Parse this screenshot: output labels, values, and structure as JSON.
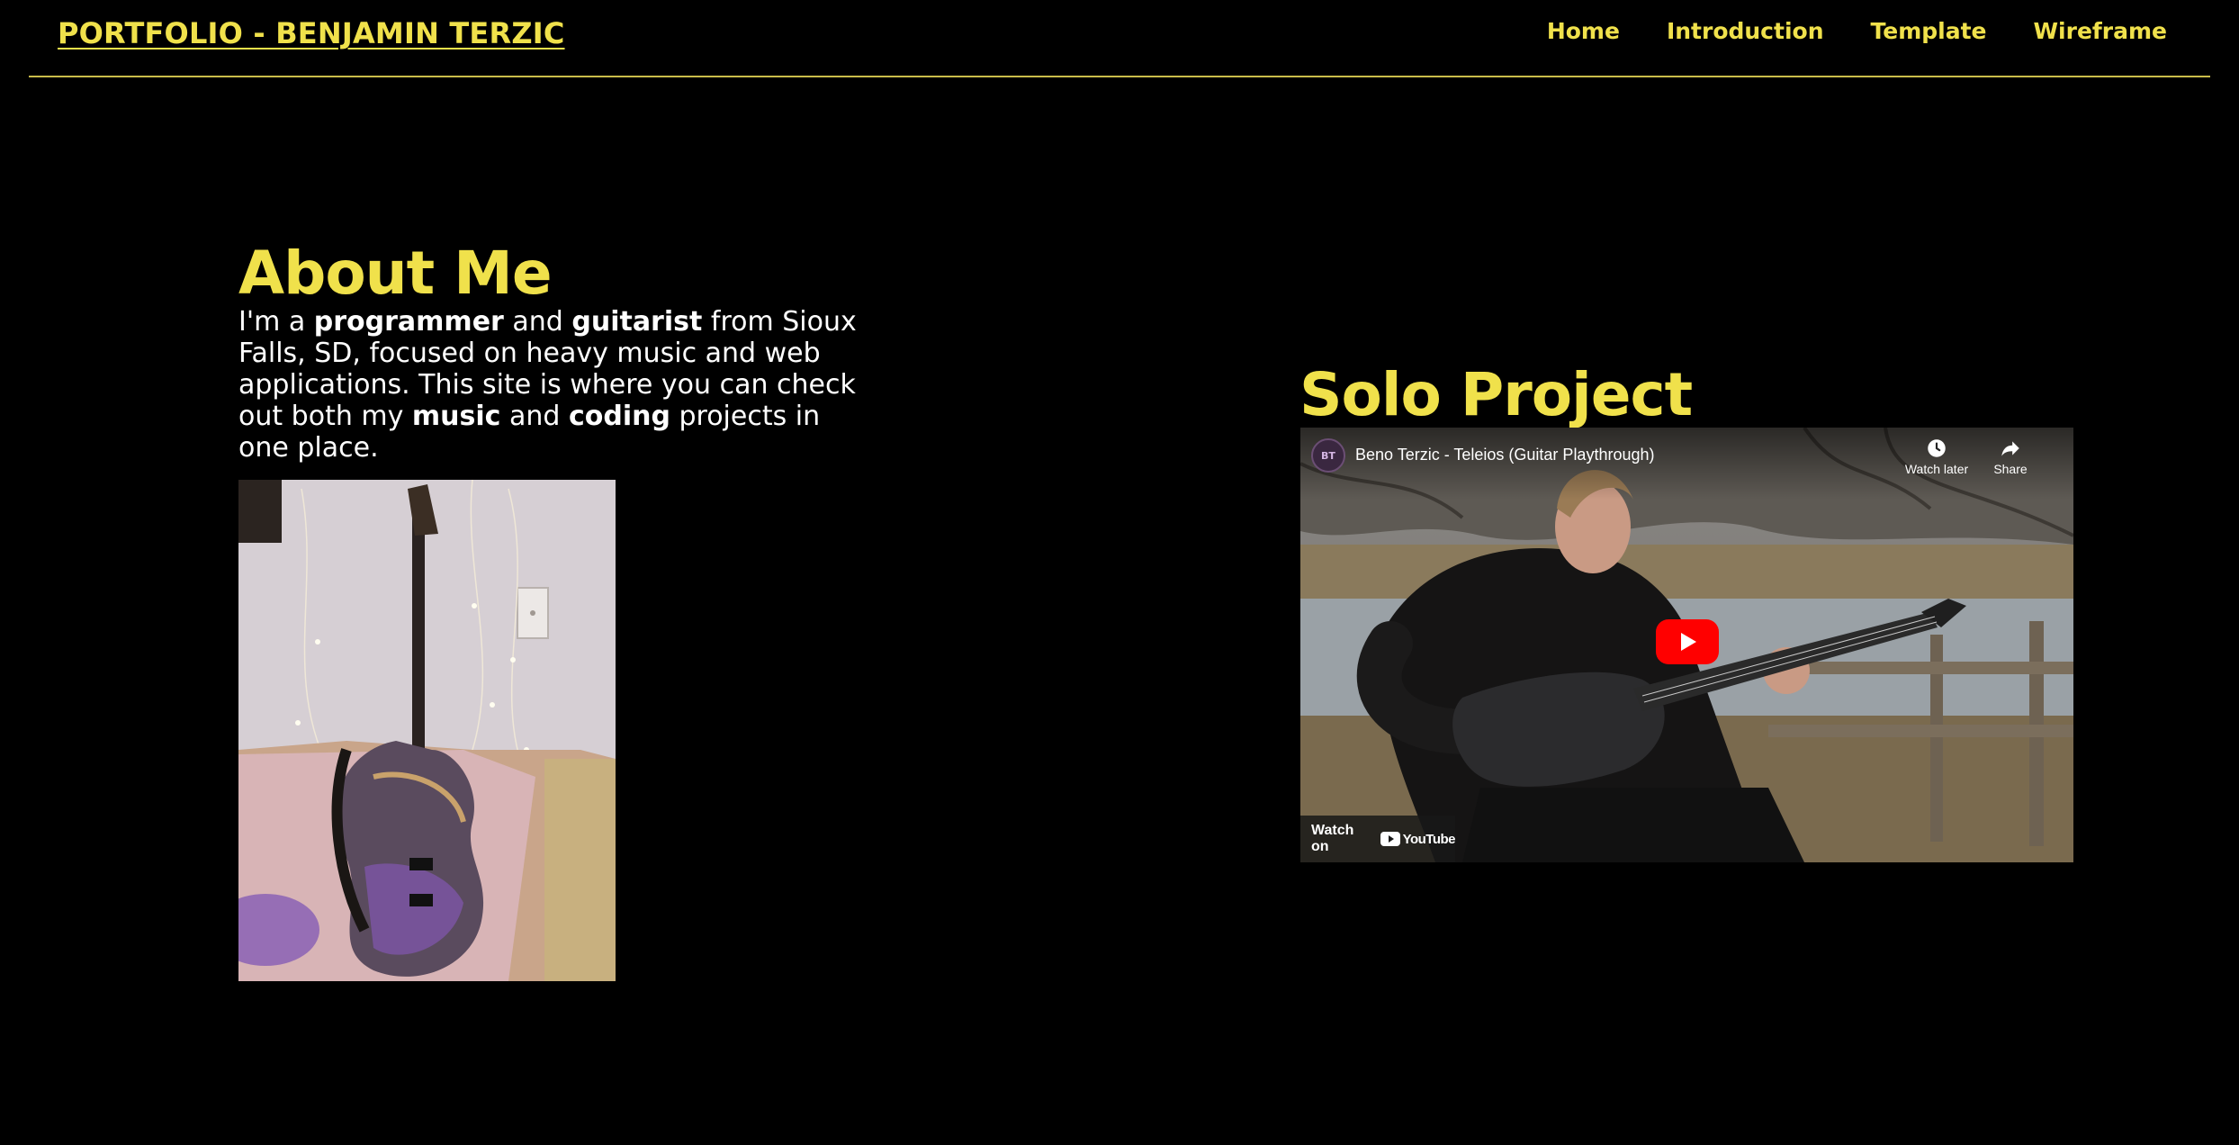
{
  "header": {
    "brand": "PORTFOLIO - BENJAMIN TERZIC",
    "nav": [
      "Home",
      "Introduction",
      "Template",
      "Wireframe"
    ]
  },
  "about": {
    "title": "About Me",
    "text_parts": [
      "I'm a ",
      "programmer",
      " and ",
      "guitarist",
      " from Sioux Falls, SD, focused on heavy music and web applications. This site is where you can check out both my ",
      "music",
      " and ",
      "coding",
      " projects in one place."
    ],
    "photo_icon": "guitar-photo"
  },
  "solo": {
    "title": "Solo Project",
    "video": {
      "title": "Beno Terzic - Teleios (Guitar Playthrough)",
      "watch_later": "Watch later",
      "share": "Share",
      "watch_on": "Watch on",
      "youtube": "YouTube"
    }
  },
  "colors": {
    "accent": "#f0e14b",
    "background": "#000000",
    "text": "#ffffff",
    "youtube_red": "#ff0000"
  }
}
